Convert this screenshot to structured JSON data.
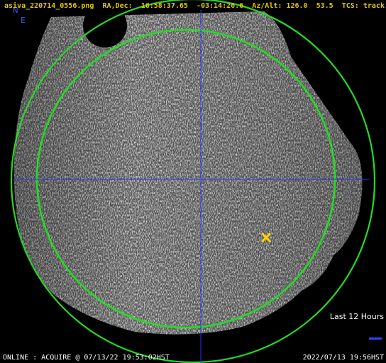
{
  "status": {
    "filename": "asiva_220714_0556.png",
    "radec_label": "RA,Dec:",
    "ra": "16:58:37.65",
    "dec": "-03:14:26.6",
    "azalt_label": "Az/Alt:",
    "az": "126.0",
    "alt": "53.5",
    "tcs_label": "TCS:",
    "tcs_state": "track"
  },
  "compass": {
    "north": "N",
    "east": "E"
  },
  "legend": {
    "last_hours": "Last 12 Hours"
  },
  "footer": {
    "left": "ONLINE : ACQUIRE @ 07/13/22 19:53:02HST",
    "right": "2022/07/13 19:56HST"
  },
  "colors": {
    "status_text": "#e6c800",
    "circle": "#22dd22",
    "crosshair": "#2233ff",
    "target_marker": "#ffd400",
    "hours_bar": "#2a45ff"
  },
  "icons": {
    "target": "x-marker-icon"
  }
}
